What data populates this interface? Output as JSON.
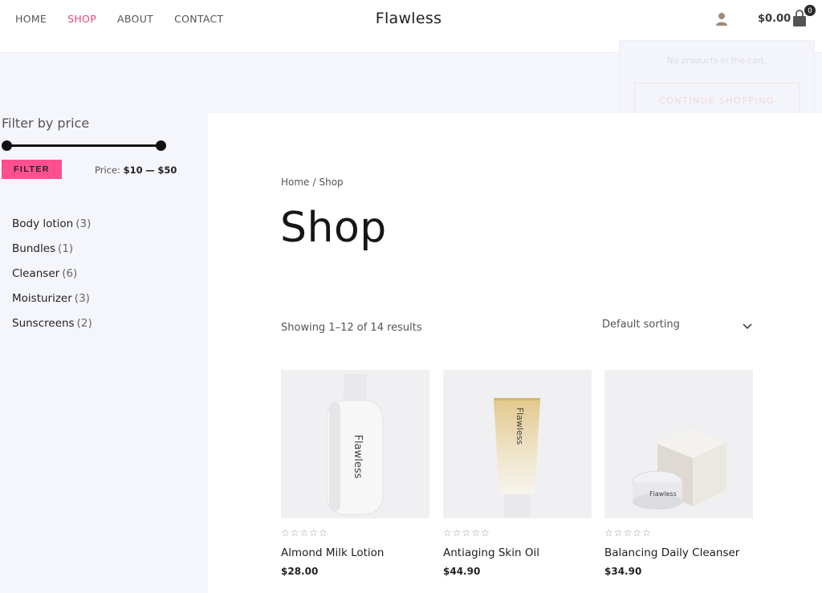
{
  "nav": {
    "items": [
      {
        "label": "HOME"
      },
      {
        "label": "SHOP"
      },
      {
        "label": "ABOUT"
      },
      {
        "label": "CONTACT"
      }
    ],
    "active": "SHOP"
  },
  "brand": "Flawless",
  "cart": {
    "total": "$0.00",
    "count": "0",
    "empty_message": "No products in the cart.",
    "continue_label": "CONTINUE SHOPPING"
  },
  "sidebar": {
    "filter_title": "Filter by price",
    "filter_button": "FILTER",
    "price_label": "Price:",
    "price_min": "$10",
    "price_separator": "—",
    "price_max": "$50",
    "categories": [
      {
        "name": "Body lotion",
        "count": "(3)"
      },
      {
        "name": "Bundles",
        "count": "(1)"
      },
      {
        "name": "Cleanser",
        "count": "(6)"
      },
      {
        "name": "Moisturizer",
        "count": "(3)"
      },
      {
        "name": "Sunscreens",
        "count": "(2)"
      }
    ]
  },
  "main": {
    "breadcrumb": {
      "home": "Home",
      "separator": "/",
      "current": "Shop"
    },
    "title": "Shop",
    "result_count": "Showing 1–12 of 14 results",
    "sorting": "Default sorting",
    "products": [
      {
        "name": "Almond Milk Lotion",
        "price": "$28.00",
        "stars": "☆☆☆☆☆",
        "bottle_text": "Flawless"
      },
      {
        "name": "Antiaging Skin Oil",
        "price": "$44.90",
        "stars": "☆☆☆☆☆",
        "bottle_text": "Flawless"
      },
      {
        "name": "Balancing Daily Cleanser",
        "price": "$34.90",
        "stars": "☆☆☆☆☆",
        "bottle_text": "Flawless"
      }
    ]
  },
  "colors": {
    "accent": "#e8467c",
    "filter_button": "#ff4f8e",
    "background": "#f5f6fb"
  }
}
